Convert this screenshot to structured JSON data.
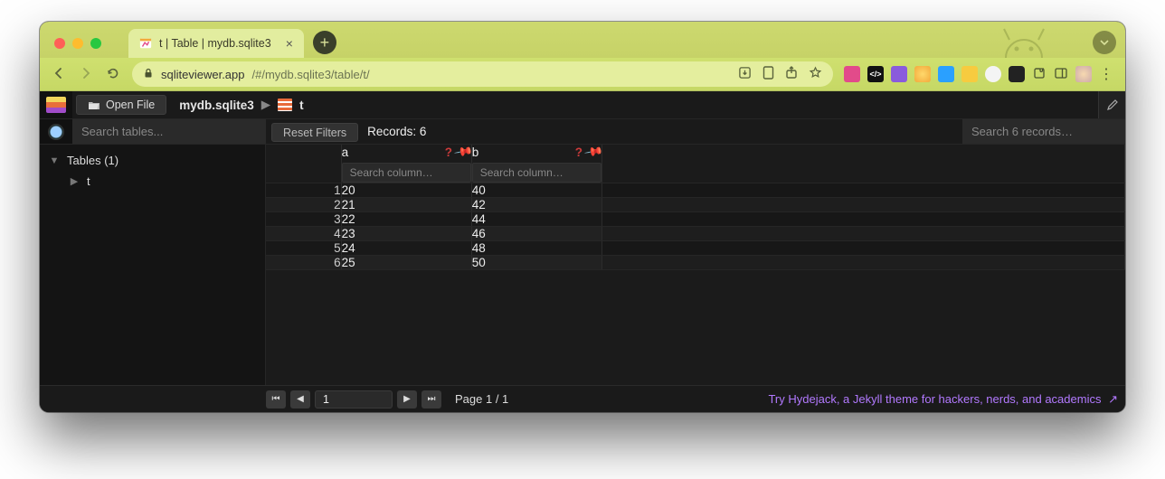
{
  "browser": {
    "tab_title": "t | Table | mydb.sqlite3",
    "url_host": "sqliteviewer.app",
    "url_path": "/#/mydb.sqlite3/table/t/"
  },
  "header": {
    "open_file_label": "Open File",
    "breadcrumb_db": "mydb.sqlite3",
    "breadcrumb_table": "t"
  },
  "controls": {
    "search_tables_placeholder": "Search tables...",
    "reset_filters_label": "Reset Filters",
    "records_label": "Records: 6",
    "search_records_placeholder": "Search 6 records…",
    "col_search_placeholder": "Search column…"
  },
  "sidebar": {
    "root_label": "Tables (1)",
    "items": [
      {
        "label": "t"
      }
    ]
  },
  "table": {
    "columns": [
      "a",
      "b"
    ],
    "rows": [
      {
        "n": "1",
        "a": "20",
        "b": "40"
      },
      {
        "n": "2",
        "a": "21",
        "b": "42"
      },
      {
        "n": "3",
        "a": "22",
        "b": "44"
      },
      {
        "n": "4",
        "a": "23",
        "b": "46"
      },
      {
        "n": "5",
        "a": "24",
        "b": "48"
      },
      {
        "n": "6",
        "a": "25",
        "b": "50"
      }
    ]
  },
  "footer": {
    "page_current": "1",
    "page_label": "Page 1 / 1",
    "link_text": "Try Hydejack, a Jekyll theme for hackers, nerds, and academics"
  }
}
